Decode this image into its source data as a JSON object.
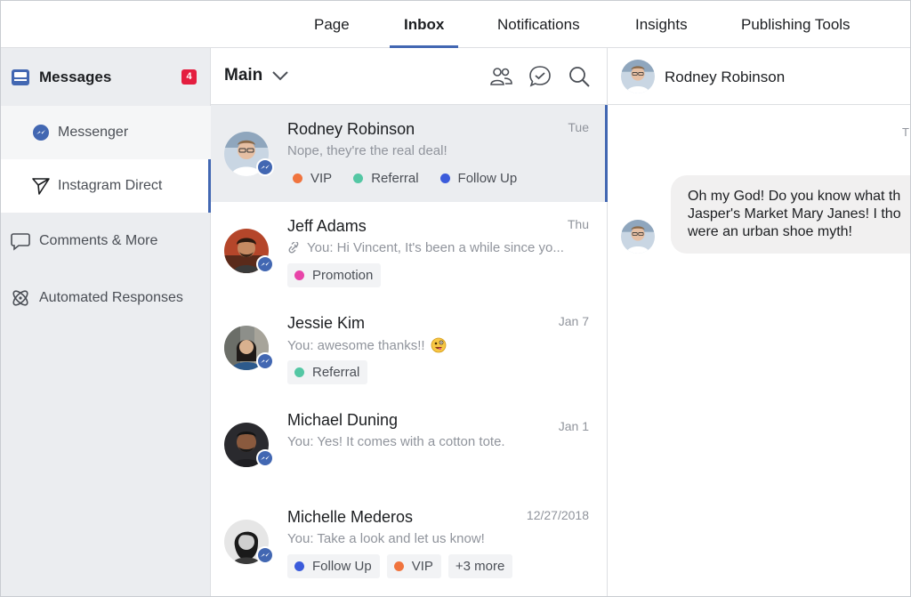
{
  "topnav": {
    "tabs": [
      {
        "label": "Page"
      },
      {
        "label": "Inbox"
      },
      {
        "label": "Notifications"
      },
      {
        "label": "Insights"
      },
      {
        "label": "Publishing Tools"
      }
    ],
    "active": "Inbox"
  },
  "sidebar": {
    "messages_label": "Messages",
    "messages_count": "4",
    "items": [
      {
        "label": "Messenger"
      },
      {
        "label": "Instagram Direct"
      },
      {
        "label": "Comments & More"
      },
      {
        "label": "Automated Responses"
      }
    ]
  },
  "list": {
    "folder": "Main",
    "conversations": [
      {
        "name": "Rodney Robinson",
        "time": "Tue",
        "snippet": "Nope, they're the real deal!",
        "tags": [
          {
            "label": "VIP",
            "color": "#f0743e"
          },
          {
            "label": "Referral",
            "color": "#54c7a4"
          },
          {
            "label": "Follow Up",
            "color": "#3b5bdb"
          }
        ]
      },
      {
        "name": "Jeff Adams",
        "time": "Thu",
        "snippet": "You: Hi Vincent, It's been a while since yo...",
        "tags": [
          {
            "label": "Promotion",
            "color": "#e844a8"
          }
        ]
      },
      {
        "name": "Jessie Kim",
        "time": "Jan 7",
        "snippet": "You: awesome thanks!!",
        "tags": [
          {
            "label": "Referral",
            "color": "#54c7a4"
          }
        ]
      },
      {
        "name": "Michael Duning",
        "time": "Jan 1",
        "snippet": "You: Yes! It comes with a cotton tote.",
        "tags": []
      },
      {
        "name": "Michelle Mederos",
        "time": "12/27/2018",
        "snippet": "You: Take a look and let us know!",
        "tags": [
          {
            "label": "Follow Up",
            "color": "#3b5bdb"
          },
          {
            "label": "VIP",
            "color": "#f0743e"
          }
        ],
        "more": "+3 more"
      }
    ]
  },
  "chat": {
    "name": "Rodney Robinson",
    "time_partial": "T",
    "message_lines": [
      "Oh my God! Do you know what th",
      "Jasper's Market Mary Janes! I tho",
      "were an urban shoe myth!"
    ]
  },
  "colors": {
    "accent": "#4267b2",
    "badge": "#e41e3f"
  }
}
